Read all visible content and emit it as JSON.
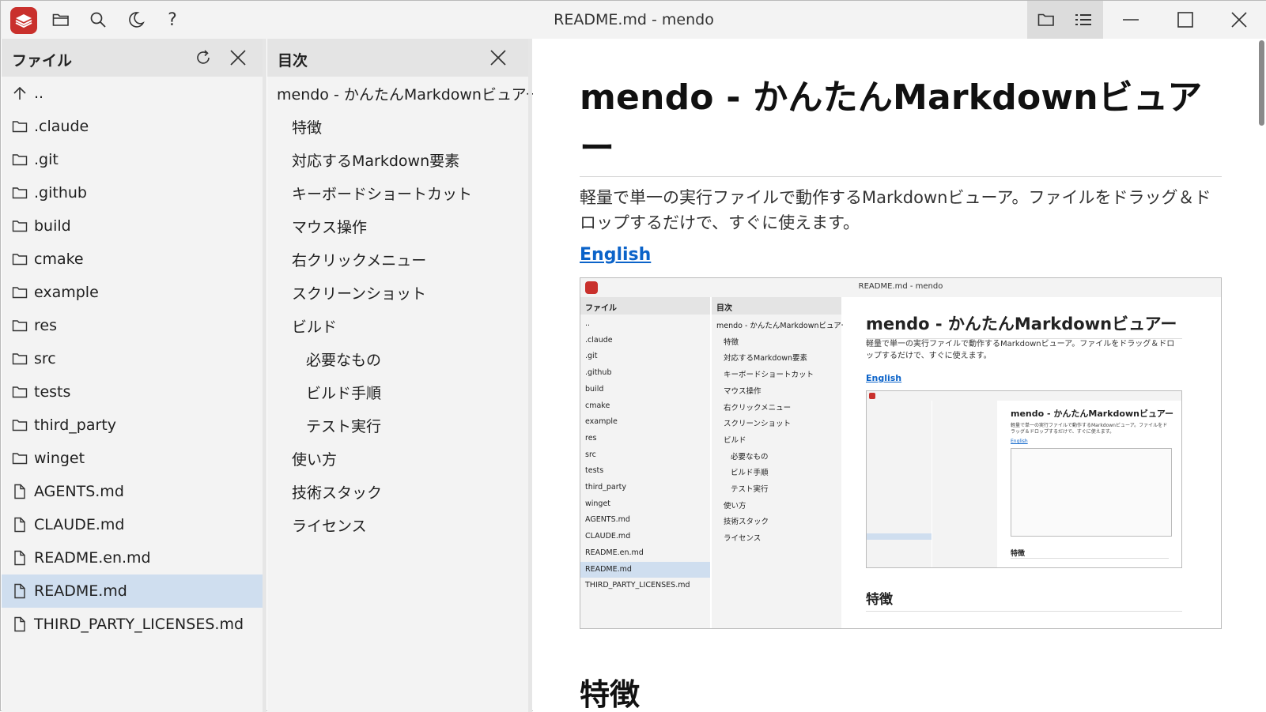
{
  "window": {
    "title": "README.md - mendo"
  },
  "toolbar": {
    "icons": [
      "app-logo-icon",
      "folder-open-icon",
      "search-icon",
      "dark-mode-icon",
      "help-icon"
    ],
    "toggle_icons": [
      "folder-icon",
      "list-icon"
    ],
    "window_controls": [
      "minimize-icon",
      "maximize-icon",
      "close-icon"
    ]
  },
  "file_panel": {
    "title": "ファイル",
    "items": [
      {
        "label": "..",
        "type": "up"
      },
      {
        "label": ".claude",
        "type": "folder"
      },
      {
        "label": ".git",
        "type": "folder"
      },
      {
        "label": ".github",
        "type": "folder"
      },
      {
        "label": "build",
        "type": "folder"
      },
      {
        "label": "cmake",
        "type": "folder"
      },
      {
        "label": "example",
        "type": "folder"
      },
      {
        "label": "res",
        "type": "folder"
      },
      {
        "label": "src",
        "type": "folder"
      },
      {
        "label": "tests",
        "type": "folder"
      },
      {
        "label": "third_party",
        "type": "folder"
      },
      {
        "label": "winget",
        "type": "folder"
      },
      {
        "label": "AGENTS.md",
        "type": "file"
      },
      {
        "label": "CLAUDE.md",
        "type": "file"
      },
      {
        "label": "README.en.md",
        "type": "file"
      },
      {
        "label": "README.md",
        "type": "file",
        "selected": true
      },
      {
        "label": "THIRD_PARTY_LICENSES.md",
        "type": "file"
      }
    ]
  },
  "toc_panel": {
    "title": "目次",
    "items": [
      {
        "label": "mendo - かんたんMarkdownビュアー",
        "level": 1
      },
      {
        "label": "特徴",
        "level": 2
      },
      {
        "label": "対応するMarkdown要素",
        "level": 2
      },
      {
        "label": "キーボードショートカット",
        "level": 2
      },
      {
        "label": "マウス操作",
        "level": 2
      },
      {
        "label": "右クリックメニュー",
        "level": 2
      },
      {
        "label": "スクリーンショット",
        "level": 2
      },
      {
        "label": "ビルド",
        "level": 2
      },
      {
        "label": "必要なもの",
        "level": 3
      },
      {
        "label": "ビルド手順",
        "level": 3
      },
      {
        "label": "テスト実行",
        "level": 3
      },
      {
        "label": "使い方",
        "level": 2
      },
      {
        "label": "技術スタック",
        "level": 2
      },
      {
        "label": "ライセンス",
        "level": 2
      }
    ]
  },
  "document": {
    "h1": "mendo - かんたんMarkdownビュアー",
    "lead": "軽量で単一の実行ファイルで動作するMarkdownビューア。ファイルをドラッグ＆ドロップするだけで、すぐに使えます。",
    "link": "English",
    "h2": "特徴"
  },
  "colors": {
    "accent": "#c9302c",
    "selection": "#cfdeef",
    "link": "#0b63c9",
    "panel_bg": "#f3f3f3",
    "panel_header_bg": "#e4e4e4"
  }
}
